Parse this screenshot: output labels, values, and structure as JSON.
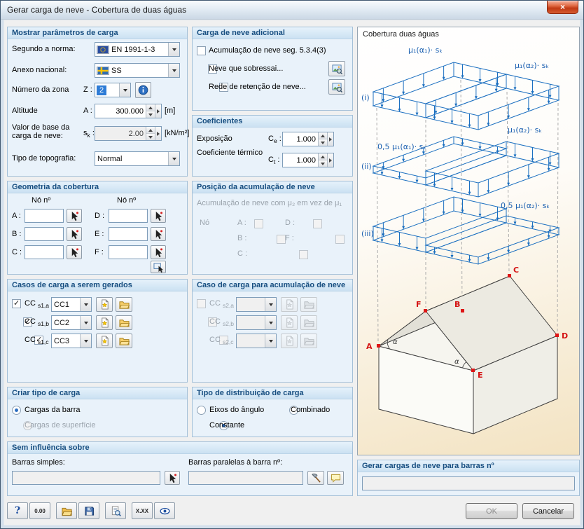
{
  "window": {
    "title": "Gerar carga de neve - Cobertura de duas águas",
    "close_glyph": "×"
  },
  "params": {
    "header": "Mostrar parâmetros de carga",
    "norm_label": "Segundo a norma:",
    "norm_value": "EN 1991-1-3",
    "annex_label": "Anexo nacional:",
    "annex_value": "SS",
    "zone_label": "Número da zona",
    "zone_sym": "Z :",
    "zone_value": "2",
    "alt_label": "Altitude",
    "alt_sym": "A :",
    "alt_value": "300.000",
    "alt_unit": "[m]",
    "base_label": "Valor de base da carga de neve:",
    "base_sym": {
      "main": "s",
      "sub": "k",
      "colon": ":"
    },
    "base_value": "2.00",
    "base_unit": "[kN/m²]",
    "topo_label": "Tipo de topografia:",
    "topo_value": "Normal"
  },
  "geometry": {
    "header": "Geometria da cobertura",
    "col_header_left": "Nó nº",
    "col_header_right": "Nó nº",
    "left_rows": [
      "A :",
      "B :",
      "C :"
    ],
    "right_rows": [
      "D :",
      "E :",
      "F :"
    ]
  },
  "load_cases": {
    "header": "Casos de carga a serem gerados",
    "items": [
      {
        "prefix": "CC ",
        "sub": "s1,a",
        "value": "CC1"
      },
      {
        "prefix": "CC ",
        "sub": "s1,b",
        "value": "CC2"
      },
      {
        "prefix": "CC ",
        "sub": "s1,c",
        "value": "CC3"
      }
    ]
  },
  "create_type": {
    "header": "Criar tipo de carga",
    "bar_option": "Cargas da barra",
    "surface_option": "Cargas de superfície"
  },
  "no_influence": {
    "header": "Sem influência sobre",
    "simple_label": "Barras simples:",
    "parallel_label": "Barras paralelas à barra nº:"
  },
  "additional": {
    "header": "Carga de neve adicional",
    "accum_option": "Acumulação de neve seg. 5.3.4(3)",
    "overhang_option": "Neve que sobressai...",
    "fence_option": "Rede de retenção de neve..."
  },
  "coefficients": {
    "header": "Coeficientes",
    "exposure_label": "Exposição",
    "exposure_sym": {
      "main": "C",
      "sub": "e",
      "colon": ":"
    },
    "exposure_value": "1.000",
    "thermal_label": "Coeficiente térmico",
    "thermal_sym": {
      "main": "C",
      "sub": "t",
      "colon": ":"
    },
    "thermal_value": "1.000"
  },
  "accum_position": {
    "header": "Posição da acumulação de neve",
    "note": "Acumulação de neve com μ₂ em vez de μ₁",
    "node_label": "Nó",
    "left_rows": [
      "A :",
      "B :",
      "C :"
    ],
    "right_rows": [
      "D :",
      "F :"
    ]
  },
  "accum_cases": {
    "header": "Caso de carga para acumulação de neve",
    "items": [
      {
        "prefix": "CC ",
        "sub": "s2,a"
      },
      {
        "prefix": "CC ",
        "sub": "s2,b"
      },
      {
        "prefix": "CC ",
        "sub": "s2,c"
      }
    ]
  },
  "distribution": {
    "header": "Tipo de distribuição de carga",
    "angle_option": "Eixos do ângulo",
    "combined_option": "Combinado",
    "constant_option": "Constante"
  },
  "preview": {
    "title": "Cobertura duas águas",
    "alpha": "α",
    "nodes": [
      "A",
      "B",
      "C",
      "D",
      "E",
      "F"
    ],
    "diagrams": [
      {
        "tag": "(i)",
        "label_left": "μ₁(α₁)· sₖ",
        "label_right": "μ₁(α₂)· sₖ",
        "factor_left": 1,
        "factor_right": 1
      },
      {
        "tag": "(ii)",
        "label_left": "0,5 μ₁(α₁)· sₖ",
        "label_right": "μ₁(α₂)· sₖ",
        "factor_left": 0.5,
        "factor_right": 1
      },
      {
        "tag": "(iii)",
        "label_right": "0,5 μ₁(α₂)· sₖ",
        "factor_left": 1,
        "factor_right": 0.5
      }
    ]
  },
  "generate": {
    "header": "Gerar cargas de neve para barras nº"
  },
  "toolbar": {
    "help": "?",
    "units": "0.00",
    "digits": "X.XX"
  },
  "footer": {
    "ok": "OK",
    "cancel": "Cancelar"
  }
}
